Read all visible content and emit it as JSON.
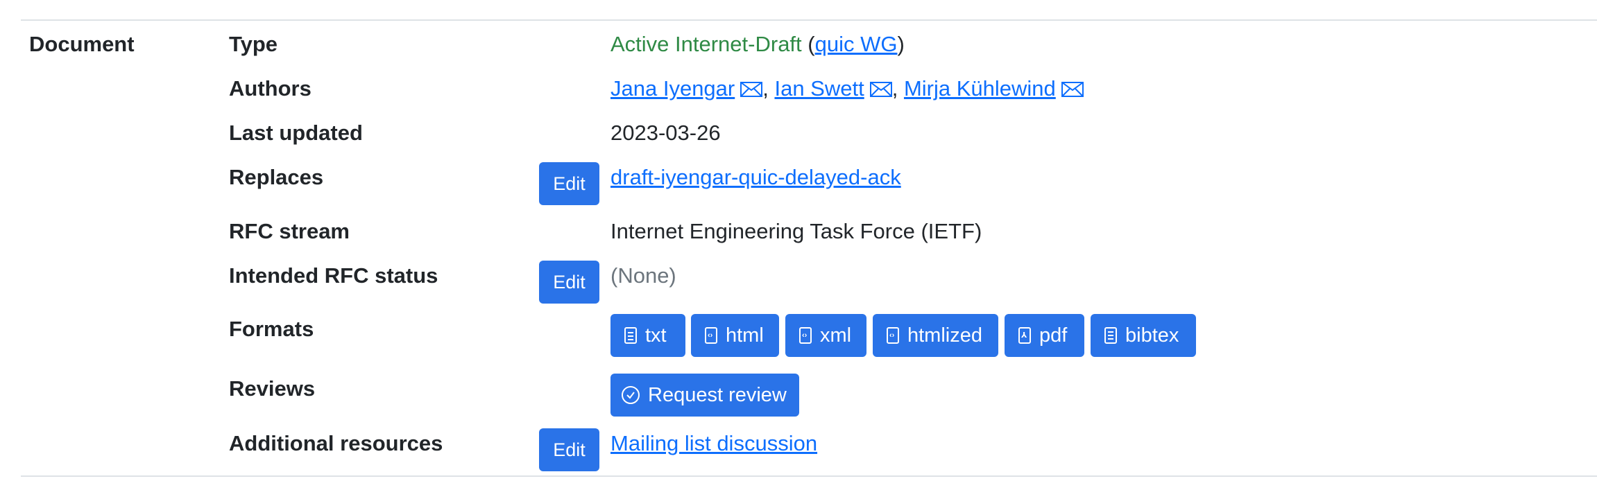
{
  "section": {
    "label": "Document"
  },
  "rows": {
    "type": {
      "label": "Type",
      "status_text": "Active Internet-Draft",
      "open_paren": " (",
      "group_link": "quic WG",
      "close_paren": ")"
    },
    "authors": {
      "label": "Authors",
      "list": [
        "Jana Iyengar",
        "Ian Swett",
        "Mirja Kühlewind"
      ],
      "separator": ", "
    },
    "last_updated": {
      "label": "Last updated",
      "value": "2023-03-26"
    },
    "replaces": {
      "label": "Replaces",
      "edit_label": "Edit",
      "link": "draft-iyengar-quic-delayed-ack"
    },
    "rfc_stream": {
      "label": "RFC stream",
      "value": "Internet Engineering Task Force (IETF)"
    },
    "intended_status": {
      "label": "Intended RFC status",
      "edit_label": "Edit",
      "value": "(None)"
    },
    "formats": {
      "label": "Formats",
      "buttons": [
        {
          "label": "txt",
          "icon": "file-text-icon"
        },
        {
          "label": "html",
          "icon": "file-code-icon"
        },
        {
          "label": "xml",
          "icon": "file-code-icon"
        },
        {
          "label": "htmlized",
          "icon": "file-code-icon"
        },
        {
          "label": "pdf",
          "icon": "file-pdf-icon"
        },
        {
          "label": "bibtex",
          "icon": "file-spreadsheet-icon"
        }
      ]
    },
    "reviews": {
      "label": "Reviews",
      "button_label": "Request review",
      "icon": "check-circle-icon"
    },
    "additional_resources": {
      "label": "Additional resources",
      "edit_label": "Edit",
      "link": "Mailing list discussion"
    }
  },
  "colors": {
    "button_blue": "#2a73e8",
    "link_blue": "#0d6efd",
    "status_green": "#2f8a45",
    "muted_gray": "#6c757d"
  }
}
